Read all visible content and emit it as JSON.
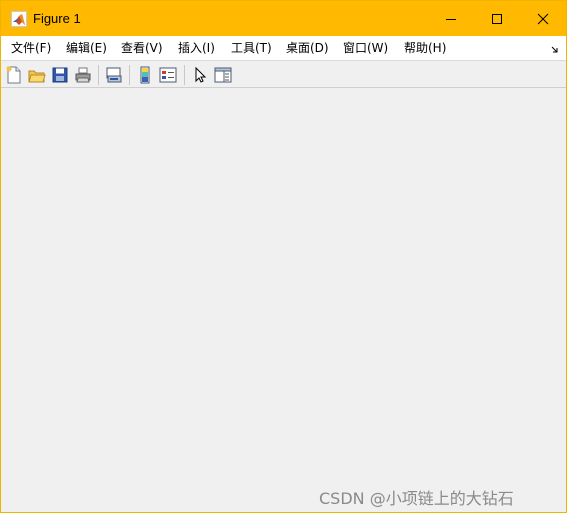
{
  "window": {
    "title": "Figure 1"
  },
  "menubar": {
    "items": [
      {
        "label": "文件(F)"
      },
      {
        "label": "编辑(E)"
      },
      {
        "label": "查看(V)"
      },
      {
        "label": "插入(I)"
      },
      {
        "label": "工具(T)"
      },
      {
        "label": "桌面(D)"
      },
      {
        "label": "窗口(W)"
      },
      {
        "label": "帮助(H)"
      }
    ]
  },
  "toolbar": {
    "buttons": [
      {
        "icon": "new-figure-icon"
      },
      {
        "icon": "open-file-icon"
      },
      {
        "icon": "save-icon"
      },
      {
        "icon": "print-icon"
      },
      {
        "icon": "link-plot-icon"
      },
      {
        "icon": "insert-colorbar-icon"
      },
      {
        "icon": "insert-legend-icon"
      },
      {
        "icon": "edit-plot-pointer-icon"
      },
      {
        "icon": "open-property-inspector-icon"
      }
    ]
  },
  "colors": {
    "titlebar": "#ffb900",
    "menubar": "#ffffff",
    "background": "#f0f0f0"
  },
  "watermark": {
    "text": "CSDN @小项链上的大钻石"
  }
}
